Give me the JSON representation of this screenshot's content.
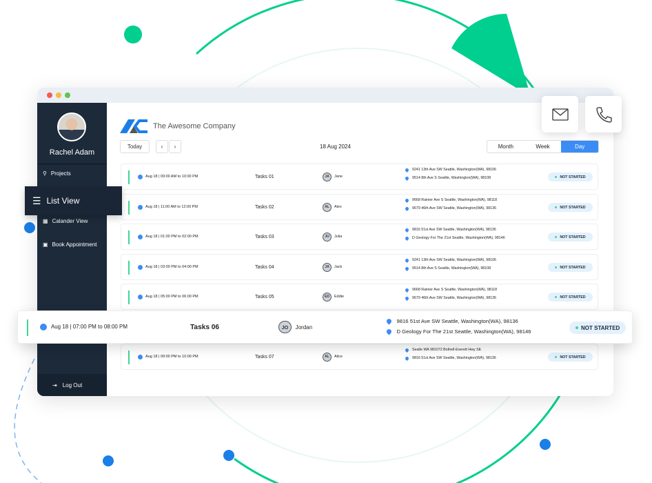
{
  "colors": {
    "accent": "#3b8cf5",
    "green": "#00cf8f",
    "sidebar": "#1c2a3a",
    "status_dot": "#3ed598"
  },
  "sidebar": {
    "user_name": "Rachel Adam",
    "items": [
      {
        "label": "Projects",
        "icon": "projects-icon"
      },
      {
        "label": "List View",
        "icon": "list-icon"
      },
      {
        "label": "Calander View",
        "icon": "calendar-icon"
      },
      {
        "label": "Book Appointment",
        "icon": "calendar-plus-icon"
      }
    ],
    "logout": "Log Out"
  },
  "header": {
    "company": "The Awesome Company",
    "today": "Today",
    "date": "18 Aug 2024",
    "views": [
      "Month",
      "Week",
      "Day"
    ],
    "active_view": "Day"
  },
  "tasks": [
    {
      "time": "Aug 18 | 09:00 AM to 10:00 PM",
      "name": "Tasks 01",
      "initials": "JA",
      "person": "Jane",
      "addr1": "9241 13th Ave SW Seattle, Washington(WA), 98106",
      "addr2": "9514 8th Ave S Seattle, Washington(WA), 98108",
      "status": "NOT STARTED"
    },
    {
      "time": "Aug 18 | 11:00 AM to 12:00 PM",
      "name": "Tasks 02",
      "initials": "AL",
      "person": "Alex",
      "addr1": "9668 Rainier Ave S Seattle, Washington(WA), 98118",
      "addr2": "9679 46th Ave SW Seattle, Washington(WA), 98136",
      "status": "NOT STARTED"
    },
    {
      "time": "Aug 18 | 01:00 PM to 02:00 PM",
      "name": "Tasks 03",
      "initials": "JU",
      "person": "Julia",
      "addr1": "9816 51st Ave SW Seattle, Washington(WA), 98136",
      "addr2": "D Geology For The 21st Seattle, Washington(WA), 98146",
      "status": "NOT STARTED"
    },
    {
      "time": "Aug 18 | 03:00 PM to 04:00 PM",
      "name": "Tasks 04",
      "initials": "JA",
      "person": "Jack",
      "addr1": "9241 13th Ave SW Seattle, Washington(WA), 98106",
      "addr2": "9514 8th Ave S Seattle, Washington(WA), 98108",
      "status": "NOT STARTED"
    },
    {
      "time": "Aug 18 | 05:00 PM to 06:00 PM",
      "name": "Tasks 05",
      "initials": "ED",
      "person": "Eddie",
      "addr1": "9668 Rainier Ave S Seattle, Washington(WA), 98118",
      "addr2": "9679 46th Ave SW Seattle, Washington(WA), 98136",
      "status": "NOT STARTED"
    },
    {
      "time": "Aug 18 | 07:00 PM to 08:00 PM",
      "name": "Tasks 06",
      "initials": "JO",
      "person": "Jordan",
      "addr1": "9816 51st Ave SW Seattle, Washington(WA), 98136",
      "addr2": "D Geology For The 21st Seattle, Washington(WA), 98146",
      "status": "NOT STARTED"
    },
    {
      "time": "Aug 18 | 09:00 PM to 10:00 PM",
      "name": "Tasks 07",
      "initials": "AL",
      "person": "Alice",
      "addr1": "Seatle WA 981072 Bothell-Everett Hwy SE",
      "addr2": "9816 51st Ave SW Seattle, Washington(WA), 98136",
      "status": "NOT STARTED"
    }
  ]
}
